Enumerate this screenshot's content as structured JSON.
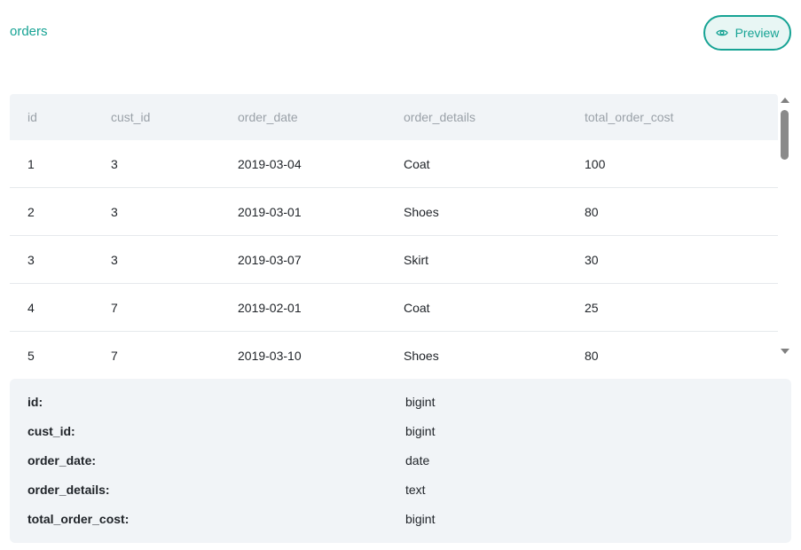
{
  "header": {
    "table_name": "orders",
    "preview_label": "Preview",
    "preview_icon": "eye-icon",
    "accent_color": "#16a394"
  },
  "grid": {
    "columns": [
      "id",
      "cust_id",
      "order_date",
      "order_details",
      "total_order_cost"
    ],
    "rows": [
      [
        "1",
        "3",
        "2019-03-04",
        "Coat",
        "100"
      ],
      [
        "2",
        "3",
        "2019-03-01",
        "Shoes",
        "80"
      ],
      [
        "3",
        "3",
        "2019-03-07",
        "Skirt",
        "30"
      ],
      [
        "4",
        "7",
        "2019-02-01",
        "Coat",
        "25"
      ],
      [
        "5",
        "7",
        "2019-03-10",
        "Shoes",
        "80"
      ]
    ]
  },
  "schema": {
    "fields": [
      {
        "name": "id:",
        "type": "bigint"
      },
      {
        "name": "cust_id:",
        "type": "bigint"
      },
      {
        "name": "order_date:",
        "type": "date"
      },
      {
        "name": "order_details:",
        "type": "text"
      },
      {
        "name": "total_order_cost:",
        "type": "bigint"
      }
    ]
  }
}
